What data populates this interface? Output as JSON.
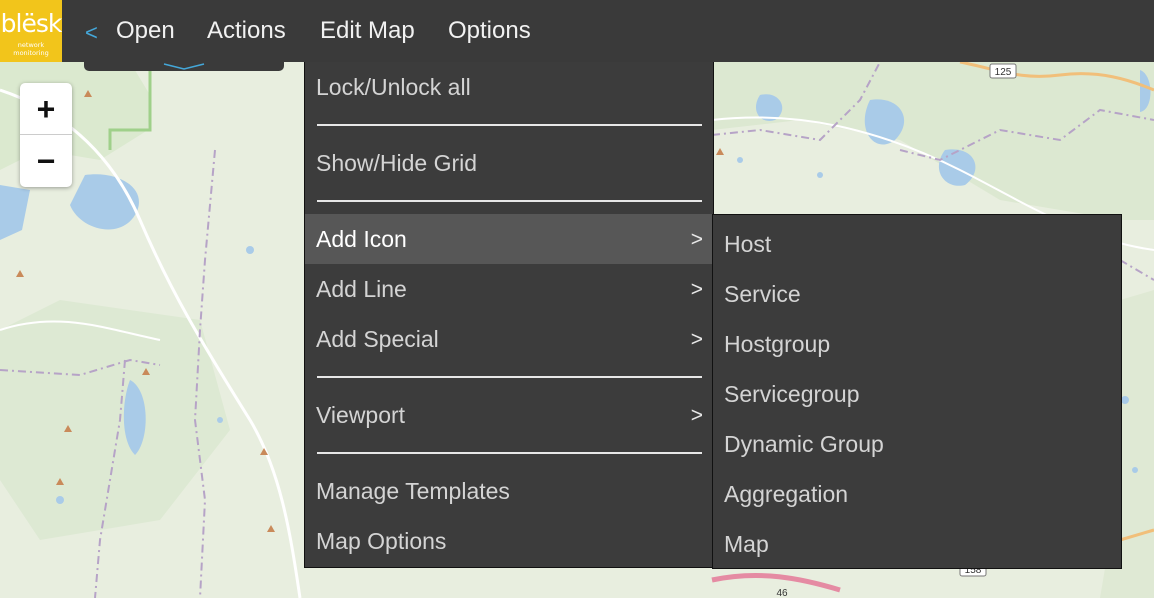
{
  "app": {
    "logo_text": "blësk",
    "logo_subtext": "network monitoring",
    "brand_color": "#f2c51b",
    "accent_color": "#44a7d9"
  },
  "nav": {
    "back_icon": "<",
    "items": [
      {
        "label": "Open"
      },
      {
        "label": "Actions"
      },
      {
        "label": "Edit Map"
      },
      {
        "label": "Options"
      }
    ]
  },
  "zoom": {
    "in_label": "+",
    "out_label": "−"
  },
  "edit_menu": {
    "items": [
      {
        "label": "Lock/Unlock all"
      },
      {
        "label": "Show/Hide Grid"
      },
      {
        "label": "Add Icon",
        "arrow": ">",
        "active": true
      },
      {
        "label": "Add Line",
        "arrow": ">"
      },
      {
        "label": "Add Special",
        "arrow": ">"
      },
      {
        "label": "Viewport",
        "arrow": ">"
      },
      {
        "label": "Manage Templates"
      },
      {
        "label": "Map Options"
      }
    ]
  },
  "add_icon_submenu": {
    "items": [
      {
        "label": "Host"
      },
      {
        "label": "Service"
      },
      {
        "label": "Hostgroup"
      },
      {
        "label": "Servicegroup"
      },
      {
        "label": "Dynamic Group"
      },
      {
        "label": "Aggregation"
      },
      {
        "label": "Map"
      }
    ]
  },
  "map": {
    "road_labels": [
      "125",
      "158",
      "46"
    ]
  }
}
